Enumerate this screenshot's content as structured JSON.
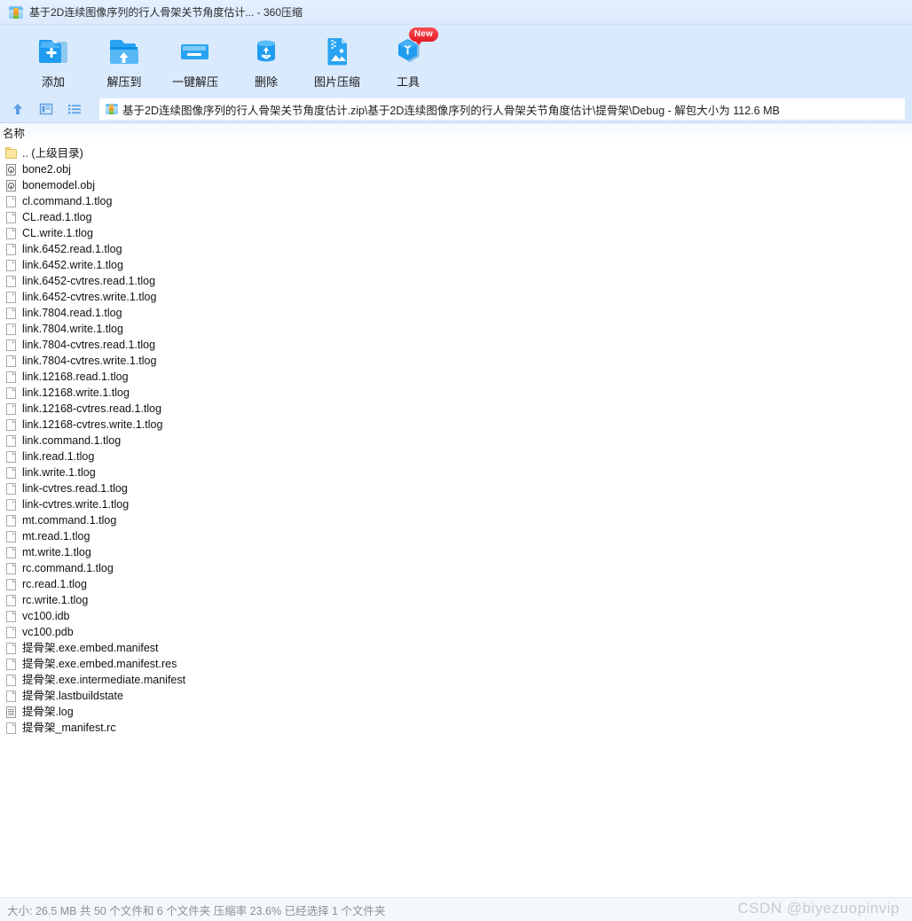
{
  "window": {
    "title": "基于2D连续图像序列的行人骨架关节角度估计... - 360压缩",
    "icon": "archive-folder-icon"
  },
  "toolbar": {
    "items": [
      {
        "label": "添加",
        "icon": "folder-add-icon"
      },
      {
        "label": "解压到",
        "icon": "folder-extract-icon"
      },
      {
        "label": "一键解压",
        "icon": "folder-onekey-extract-icon"
      },
      {
        "label": "删除",
        "icon": "recycle-bin-icon"
      },
      {
        "label": "图片压缩",
        "icon": "image-compress-icon"
      },
      {
        "label": "工具",
        "icon": "tools-hexagon-icon",
        "badge": "New"
      }
    ]
  },
  "navbar": {
    "up_button": "up-arrow-icon",
    "preview_button": "preview-pane-icon",
    "listview_button": "list-view-icon",
    "path": "基于2D连续图像序列的行人骨架关节角度估计.zip\\基于2D连续图像序列的行人骨架关节角度估计\\提骨架\\Debug - 解包大小为 112.6 MB"
  },
  "list": {
    "columns": [
      "名称"
    ],
    "rows": [
      {
        "name": ".. (上级目录)",
        "icon": "folder"
      },
      {
        "name": "bone2.obj",
        "icon": "obj"
      },
      {
        "name": "bonemodel.obj",
        "icon": "obj"
      },
      {
        "name": "cl.command.1.tlog",
        "icon": "doc"
      },
      {
        "name": "CL.read.1.tlog",
        "icon": "doc"
      },
      {
        "name": "CL.write.1.tlog",
        "icon": "doc"
      },
      {
        "name": "link.6452.read.1.tlog",
        "icon": "doc"
      },
      {
        "name": "link.6452.write.1.tlog",
        "icon": "doc"
      },
      {
        "name": "link.6452-cvtres.read.1.tlog",
        "icon": "doc"
      },
      {
        "name": "link.6452-cvtres.write.1.tlog",
        "icon": "doc"
      },
      {
        "name": "link.7804.read.1.tlog",
        "icon": "doc"
      },
      {
        "name": "link.7804.write.1.tlog",
        "icon": "doc"
      },
      {
        "name": "link.7804-cvtres.read.1.tlog",
        "icon": "doc"
      },
      {
        "name": "link.7804-cvtres.write.1.tlog",
        "icon": "doc"
      },
      {
        "name": "link.12168.read.1.tlog",
        "icon": "doc"
      },
      {
        "name": "link.12168.write.1.tlog",
        "icon": "doc"
      },
      {
        "name": "link.12168-cvtres.read.1.tlog",
        "icon": "doc"
      },
      {
        "name": "link.12168-cvtres.write.1.tlog",
        "icon": "doc"
      },
      {
        "name": "link.command.1.tlog",
        "icon": "doc"
      },
      {
        "name": "link.read.1.tlog",
        "icon": "doc"
      },
      {
        "name": "link.write.1.tlog",
        "icon": "doc"
      },
      {
        "name": "link-cvtres.read.1.tlog",
        "icon": "doc"
      },
      {
        "name": "link-cvtres.write.1.tlog",
        "icon": "doc"
      },
      {
        "name": "mt.command.1.tlog",
        "icon": "doc"
      },
      {
        "name": "mt.read.1.tlog",
        "icon": "doc"
      },
      {
        "name": "mt.write.1.tlog",
        "icon": "doc"
      },
      {
        "name": "rc.command.1.tlog",
        "icon": "doc"
      },
      {
        "name": "rc.read.1.tlog",
        "icon": "doc"
      },
      {
        "name": "rc.write.1.tlog",
        "icon": "doc"
      },
      {
        "name": "vc100.idb",
        "icon": "doc"
      },
      {
        "name": "vc100.pdb",
        "icon": "doc"
      },
      {
        "name": "提骨架.exe.embed.manifest",
        "icon": "doc"
      },
      {
        "name": "提骨架.exe.embed.manifest.res",
        "icon": "doc"
      },
      {
        "name": "提骨架.exe.intermediate.manifest",
        "icon": "doc"
      },
      {
        "name": "提骨架.lastbuildstate",
        "icon": "doc"
      },
      {
        "name": "提骨架.log",
        "icon": "log"
      },
      {
        "name": "提骨架_manifest.rc",
        "icon": "doc"
      }
    ]
  },
  "statusbar": {
    "text": "大小: 26.5 MB 共 50 个文件和 6 个文件夹 压缩率 23.6% 已经选择 1 个文件夹"
  },
  "watermark": {
    "text": "CSDN @biyezuopinvip"
  },
  "colors": {
    "accent_blue": "#2196f3",
    "badge_red": "#e41d26",
    "bg_blue": "#d3e7fc",
    "folder_yellow": "#fbe7a3"
  }
}
